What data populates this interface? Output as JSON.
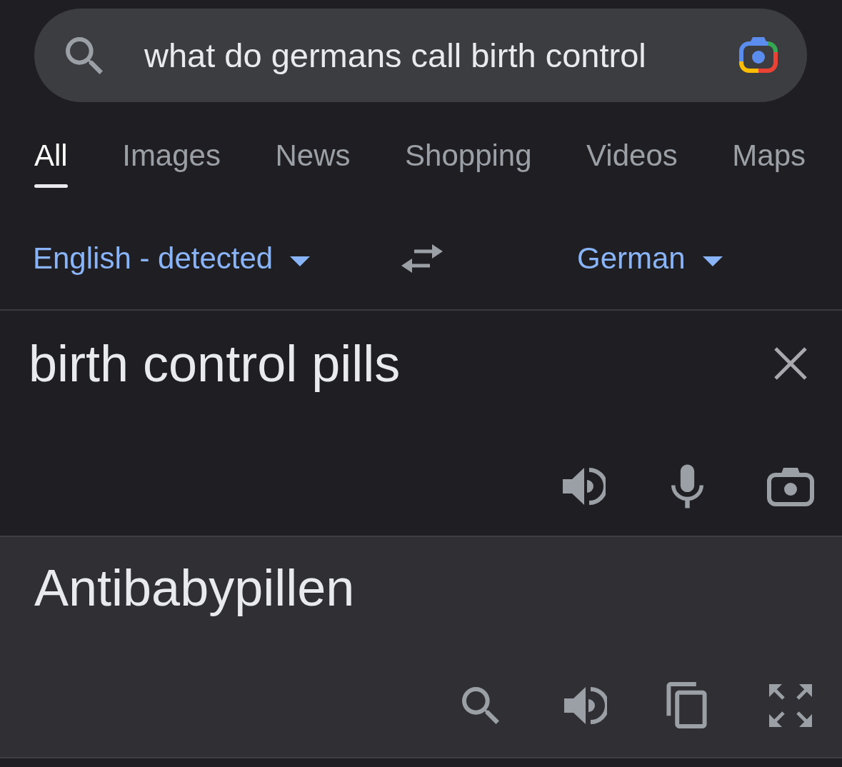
{
  "search_bar": {
    "query": "what do germans call birth control"
  },
  "tabs": [
    {
      "label": "All",
      "selected": true
    },
    {
      "label": "Images",
      "selected": false
    },
    {
      "label": "News",
      "selected": false
    },
    {
      "label": "Shopping",
      "selected": false
    },
    {
      "label": "Videos",
      "selected": false
    },
    {
      "label": "Maps",
      "selected": false
    }
  ],
  "translator": {
    "source_language": "English - detected",
    "target_language": "German",
    "source_text": "birth control pills",
    "translation": "Antibabypillen"
  }
}
